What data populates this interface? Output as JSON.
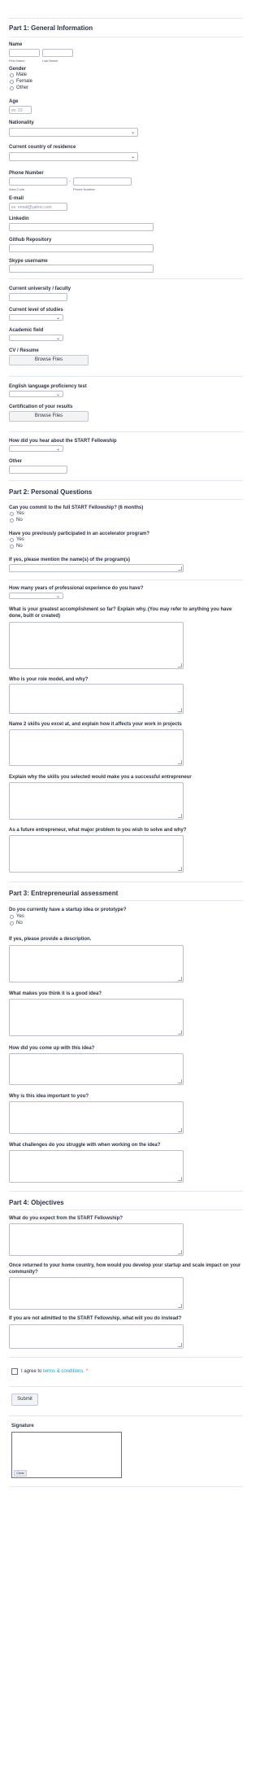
{
  "part1": {
    "title": "Part 1: General Information",
    "name_label": "Name",
    "first_name_sub": "First Name",
    "last_name_sub": "Last Name",
    "gender_label": "Gender",
    "gender_options": [
      "Male",
      "Female",
      "Other"
    ],
    "age_label": "Age",
    "age_placeholder": "ex: 23",
    "nationality_label": "Nationality",
    "country_label": "Current country of residence",
    "phone_label": "Phone Number",
    "area_code_sub": "Area Code",
    "phone_number_sub": "Phone Number",
    "email_label": "E-mail",
    "email_placeholder": "ex: email@yahoo.com",
    "linkedin_label": "Linkedin",
    "github_label": "Github Repository",
    "skype_label": "Skype username",
    "university_label": "Current university / faculty",
    "level_label": "Current level of studies",
    "academic_label": "Academic field",
    "cv_label": "CV / Resume",
    "browse_label": "Browse Files",
    "english_label": "English language proficiency test",
    "certification_label": "Certification of your results",
    "browse_label_2": "Browse Files",
    "hear_label": "How did you hear about the START Fellowship",
    "other_label": "Other"
  },
  "part2": {
    "title": "Part 2: Personal Questions",
    "commit_label": "Can you commit to the full START Fellowship? (6 months)",
    "commit_options": [
      "Yes",
      "No"
    ],
    "accelerator_label": "Have you previously participated in an accelerator program?",
    "accelerator_options": [
      "Yes",
      "No"
    ],
    "program_name_label": "If yes, please mention the name(s) of the program(s)",
    "experience_label": "How many years of professional experience do you have?",
    "accomplishment_label": "What is your greatest accomplishment so far? Explain why. (You may refer to anything you have done, built or created)",
    "role_model_label": "Who is your role model, and why?",
    "skills_label": "Name 2 skills you excel at, and explain how it affects your work in projects",
    "skills_why_label": "Explain why the skills you selected would make you a successful entrepreneur",
    "problem_label": "As a future entrepreneur, what major problem to you wish to solve and why?"
  },
  "part3": {
    "title": "Part 3: Entrepreneurial assessment",
    "startup_label": "Do you currently have a startup idea or prototype?",
    "startup_options": [
      "Yes",
      "No"
    ],
    "description_label": "If yes, please provide a description.",
    "good_idea_label": "What makes you think it is a good idea?",
    "come_up_label": "How did you come up with this idea?",
    "important_label": "Why is this idea important to you?",
    "challenges_label": "What challenges do you struggle with when working on the idea?"
  },
  "part4": {
    "title": "Part 4: Objectives",
    "expect_label": "What do you expect from the START Fellowship?",
    "home_label": "Once returned to your home country, how would you develop your startup and scale impact on your community?",
    "not_admitted_label": "If you are not admitted to the START Fellowship, what will you do instead?"
  },
  "terms": {
    "prefix": "I agree to",
    "link": "terms & conditions.",
    "required_mark": "*"
  },
  "submit_label": "Submit",
  "signature": {
    "label": "Signature",
    "clear_label": "Clear"
  }
}
